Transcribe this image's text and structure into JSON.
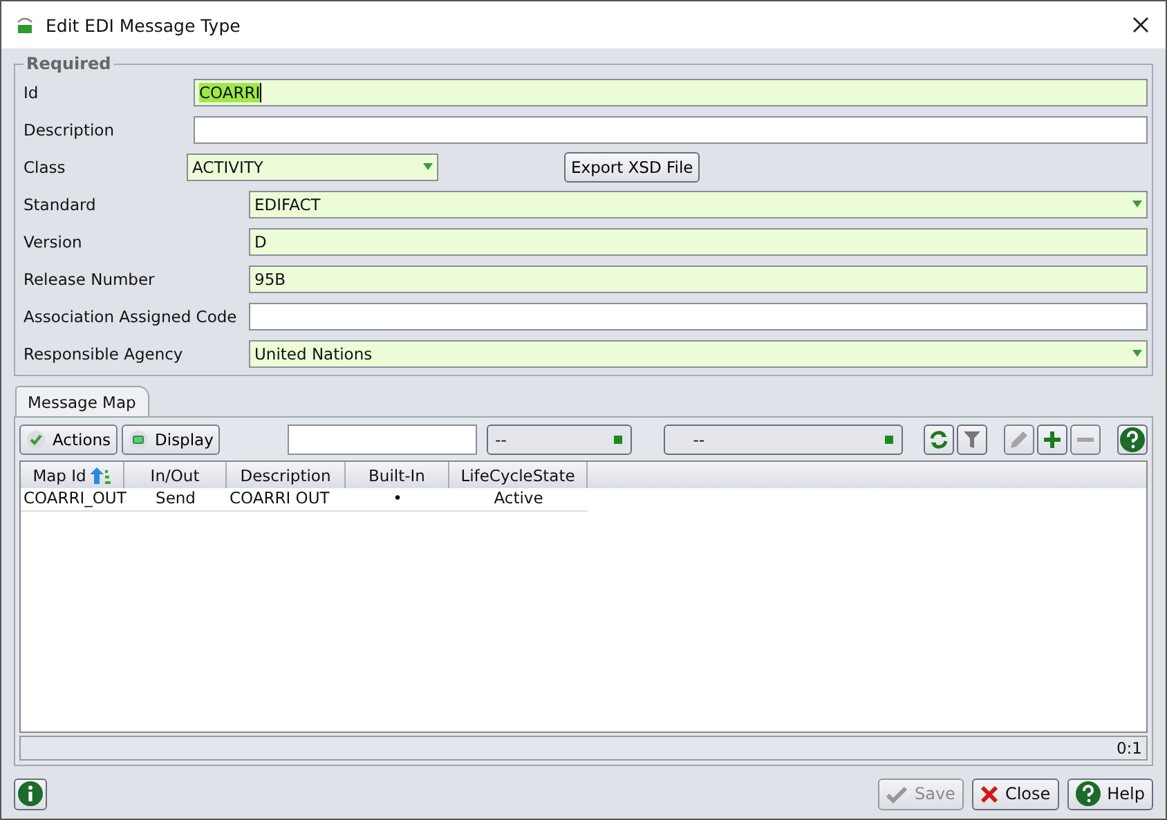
{
  "window": {
    "title": "Edit EDI Message Type"
  },
  "required_group": {
    "title": "Required",
    "fields": [
      {
        "label": "Id",
        "kind": "text",
        "value": "COARRI",
        "required": true,
        "value_selected": true
      },
      {
        "label": "Description",
        "kind": "text",
        "required": false
      },
      {
        "label": "Class",
        "kind": "select",
        "value": "ACTIVITY",
        "required": true
      },
      {
        "label": "Standard",
        "kind": "select",
        "value": "EDIFACT",
        "required": true
      },
      {
        "label": "Version",
        "kind": "text",
        "value": "D",
        "required": true
      },
      {
        "label": "Release Number",
        "kind": "text",
        "value": "95B",
        "required": true
      },
      {
        "label": "Association Assigned Code",
        "kind": "text",
        "required": false
      },
      {
        "label": "Responsible Agency",
        "kind": "select",
        "value": "United Nations",
        "required": true
      }
    ],
    "export_button": "Export XSD File"
  },
  "tabs": [
    {
      "label": "Message Map",
      "selected": true
    }
  ],
  "toolbar": {
    "actions_button": "Actions",
    "display_button": "Display",
    "combos": [
      "--",
      "--"
    ],
    "icon_buttons": [
      {
        "kind": "refresh",
        "disabled": false
      },
      {
        "kind": "filter",
        "disabled": false
      },
      {
        "kind": "edit",
        "disabled": true
      },
      {
        "kind": "add",
        "disabled": false
      },
      {
        "kind": "remove",
        "disabled": true
      },
      {
        "kind": "help",
        "disabled": false
      }
    ]
  },
  "table": {
    "columns": [
      {
        "label": "Map Id",
        "sorted": true
      },
      {
        "label": "In/Out",
        "sorted": false
      },
      {
        "label": "Description",
        "sorted": false
      },
      {
        "label": "Built-In",
        "sorted": false
      },
      {
        "label": "LifeCycleState",
        "sorted": false
      }
    ],
    "rows": [
      [
        "COARRI_OUT",
        "Send",
        "COARRI OUT",
        "•",
        "Active"
      ]
    ],
    "count": "0:1"
  },
  "footer": {
    "buttons": [
      {
        "kind": "save",
        "label": "Save",
        "disabled": true
      },
      {
        "kind": "close",
        "label": "Close",
        "disabled": false
      },
      {
        "kind": "help",
        "label": "Help",
        "disabled": false
      }
    ]
  }
}
